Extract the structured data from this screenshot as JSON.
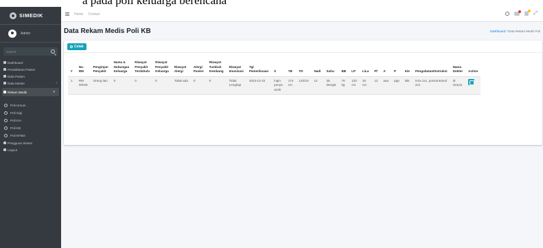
{
  "caption": {
    "text": "a pada poli keluarga berencana"
  },
  "brand": {
    "name": "SIMEDIK"
  },
  "user": {
    "name": "Admin"
  },
  "search": {
    "placeholder": "Search"
  },
  "sidebar": {
    "items": [
      {
        "label": "Dashboard"
      },
      {
        "label": "Pendaftaran Pasien"
      },
      {
        "label": "Data Pasien"
      },
      {
        "label": "Data Master"
      },
      {
        "label": "Rekam Medik"
      }
    ],
    "sub_items": [
      {
        "label": "Poli Umum"
      },
      {
        "label": "Poli Gigi"
      },
      {
        "label": "Poli KIA"
      },
      {
        "label": "Poli KB"
      },
      {
        "label": "Poli MTBS"
      }
    ],
    "bottom_items": [
      {
        "label": "Pengguna Sistem"
      },
      {
        "label": "Logout"
      }
    ]
  },
  "topnav": {
    "links": [
      "Home",
      "Contact"
    ]
  },
  "page": {
    "title": "Data Rekam Medis Poli KB",
    "breadcrumb_home": "Dashboard",
    "breadcrumb_sep": "/",
    "breadcrumb_current": "Data Rekam Medis Poli"
  },
  "toolbar": {
    "print_label": "Cetak"
  },
  "table": {
    "headers": [
      [
        "#"
      ],
      [
        "No.",
        "RM"
      ],
      [
        "Penginjan",
        "Penyakit"
      ],
      [
        "Nama &",
        "Hubungan",
        "Keluarga"
      ],
      [
        "Riwayat",
        "Penyakit",
        "Terdahulu"
      ],
      [
        "Riwayat",
        "Penyakit",
        "Keluarga"
      ],
      [
        "Riwayat",
        "Alergi"
      ],
      [
        "Alergi",
        "Pasien"
      ],
      [
        "Riwayat",
        "Tumbuh",
        "Kembang"
      ],
      [
        "Riwayat",
        "Imunisasi"
      ],
      [
        "Tgl",
        "Pemeriksaan"
      ],
      [
        "S"
      ],
      [
        "TB"
      ],
      [
        "TD"
      ],
      [
        "Nadi"
      ],
      [
        "Suhu"
      ],
      [
        "BB"
      ],
      [
        "LP"
      ],
      [
        "LiLa"
      ],
      [
        "Pf"
      ],
      [
        "A"
      ],
      [
        "P"
      ],
      [
        "Kie"
      ],
      [
        "Pengobatan/Instruksi"
      ],
      [
        "Nama",
        "Dokter"
      ],
      [
        "Action"
      ]
    ],
    "rows": [
      [
        [
          "1."
        ],
        [
          "RM",
          "00045"
        ],
        [
          "Orang lain"
        ],
        [
          "0"
        ],
        [
          "0"
        ],
        [
          "0"
        ],
        [
          "Tidak ada"
        ],
        [
          "0"
        ],
        [
          "0"
        ],
        [
          "Tidak",
          "Lengkap"
        ],
        [
          "2023-12-22"
        ],
        [
          "ingin",
          "punya",
          "anak"
        ],
        [
          "174",
          "cm"
        ],
        [
          "120/10"
        ],
        [
          "12"
        ],
        [
          "35",
          "derajat"
        ],
        [
          "70",
          "kg"
        ],
        [
          "120",
          "cm"
        ],
        [
          "15",
          "cm"
        ],
        [
          "12"
        ],
        [
          "aaa"
        ],
        [
          "ppp"
        ],
        [
          "kkk"
        ],
        [
          "Inza 1x1, ponsontomol",
          "2x1"
        ],
        [
          "dr.",
          "Gracia"
        ],
        []
      ]
    ]
  },
  "colors": {
    "sidebar": "#343a40",
    "accent": "#17a2b8",
    "content_bg": "#f4f6f9"
  }
}
